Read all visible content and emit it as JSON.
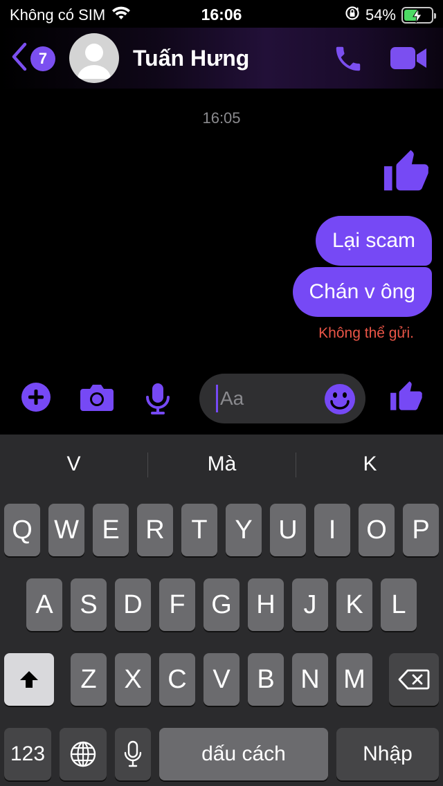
{
  "status_bar": {
    "carrier": "Không có SIM",
    "time": "16:06",
    "battery_percent": "54%",
    "battery_level": 0.54,
    "icons": [
      "wifi-icon",
      "orientation-lock-icon",
      "battery-charging-icon"
    ]
  },
  "header": {
    "back_badge": "7",
    "contact_name": "Tuấn Hưng",
    "icons": [
      "back-chevron-icon",
      "avatar-placeholder-icon",
      "phone-icon",
      "video-camera-icon"
    ]
  },
  "conversation": {
    "timestamp": "16:05",
    "messages": [
      {
        "type": "sticker",
        "icon": "thumbs-up-icon"
      },
      {
        "type": "text",
        "text": "Lại scam"
      },
      {
        "type": "text",
        "text": "Chán v ông"
      }
    ],
    "error_text": "Không thể gửi."
  },
  "composer": {
    "placeholder": "Aa",
    "icons": [
      "plus-circle-icon",
      "camera-icon",
      "microphone-icon",
      "emoji-icon",
      "thumbs-up-icon"
    ]
  },
  "keyboard": {
    "suggestions": [
      "V",
      "Mà",
      "K"
    ],
    "row1": [
      "Q",
      "W",
      "E",
      "R",
      "T",
      "Y",
      "U",
      "I",
      "O",
      "P"
    ],
    "row2": [
      "A",
      "S",
      "D",
      "F",
      "G",
      "H",
      "J",
      "K",
      "L"
    ],
    "row3": [
      "Z",
      "X",
      "C",
      "V",
      "B",
      "N",
      "M"
    ],
    "numbers_key": "123",
    "space_key": "dấu cách",
    "return_key": "Nhập",
    "icons": [
      "shift-icon",
      "backspace-icon",
      "globe-icon",
      "dictation-icon"
    ]
  },
  "colors": {
    "accent": "#7649f5",
    "error": "#ea5547",
    "keyboard_bg": "#2b2b2d",
    "key_bg": "#6b6b6e"
  }
}
